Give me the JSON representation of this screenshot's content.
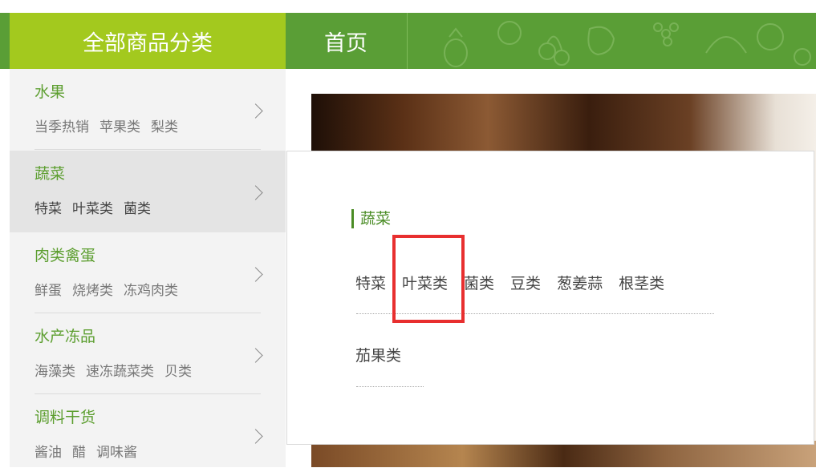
{
  "nav": {
    "all_categories_label": "全部商品分类",
    "home_label": "首页",
    "colors": {
      "bar": "#5a9e36",
      "all_categories_bg": "#a3c91e"
    }
  },
  "sidebar": {
    "categories": [
      {
        "title": "水果",
        "subs": [
          "当季热销",
          "苹果类",
          "梨类"
        ]
      },
      {
        "title": "蔬菜",
        "subs": [
          "特菜",
          "叶菜类",
          "菌类"
        ]
      },
      {
        "title": "肉类禽蛋",
        "subs": [
          "鲜蛋",
          "烧烤类",
          "冻鸡肉类"
        ]
      },
      {
        "title": "水产冻品",
        "subs": [
          "海藻类",
          "速冻蔬菜类",
          "贝类"
        ]
      },
      {
        "title": "调料干货",
        "subs": [
          "酱油",
          "醋",
          "调味酱"
        ]
      }
    ],
    "active_index": 1
  },
  "panel": {
    "title": "蔬菜",
    "row1": [
      "特菜",
      "叶菜类",
      "菌类",
      "豆类",
      "葱姜蒜",
      "根茎类"
    ],
    "row2": [
      "茄果类"
    ]
  },
  "highlight_color": "#e82f2f"
}
